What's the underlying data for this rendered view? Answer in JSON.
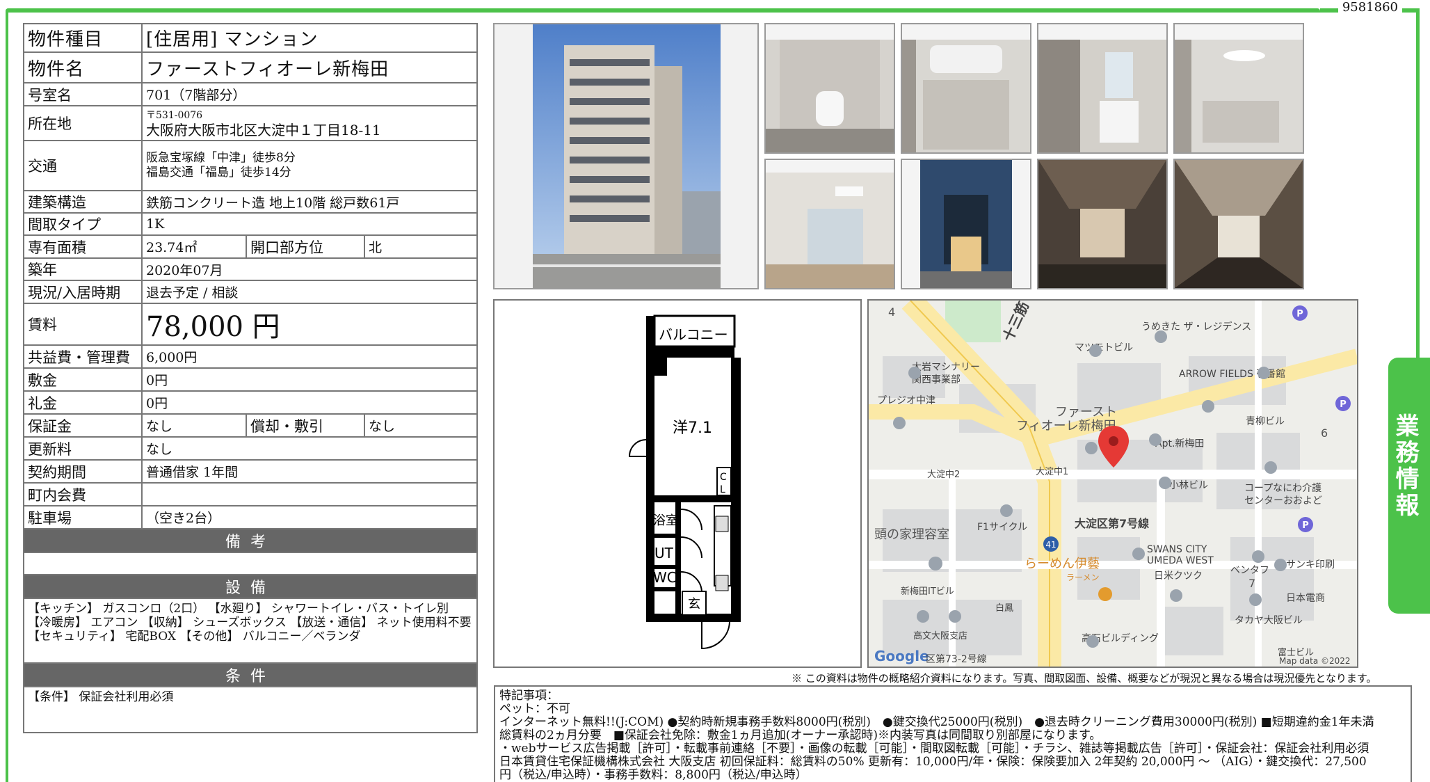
{
  "doc_id": "9581860",
  "rows": {
    "type_label": "物件種目",
    "type_value": "[住居用] マンション",
    "name_label": "物件名",
    "name_value": "ファーストフィオーレ新梅田",
    "room_label": "号室名",
    "room_value": "701（7階部分）",
    "addr_label": "所在地",
    "zip": "〒531-0076",
    "addr_value": "大阪府大阪市北区大淀中１丁目18-11",
    "transit_label": "交通",
    "transit_1": "阪急宝塚線「中津」徒歩8分",
    "transit_2": "福島交通「福島」徒歩14分",
    "structure_label": "建築構造",
    "structure_value": "鉄筋コンクリート造 地上10階 総戸数61戸",
    "layout_label": "間取タイプ",
    "layout_value": "1K",
    "area_label": "専有面積",
    "area_value": "23.74㎡",
    "dir_label": "開口部方位",
    "dir_value": "北",
    "built_label": "築年",
    "built_value": "2020年07月",
    "status_label": "現況/入居時期",
    "status_value": "退去予定 / 相談",
    "rent_label": "賃料",
    "rent_value": "78,000 円",
    "fee_label": "共益費・管理費",
    "fee_value": "6,000円",
    "deposit_label": "敷金",
    "deposit_value": "0円",
    "keymoney_label": "礼金",
    "keymoney_value": "0円",
    "guarantee_label": "保証金",
    "guarantee_value": "なし",
    "amort_label": "償却・敷引",
    "amort_value": "なし",
    "renewal_label": "更新料",
    "renewal_value": "なし",
    "contract_label": "契約期間",
    "contract_value": "普通借家 1年間",
    "assoc_label": "町内会費",
    "assoc_value": "",
    "parking_label": "駐車場",
    "parking_value": "（空き2台）"
  },
  "sections": {
    "remarks_title": "備考",
    "remarks_text": "",
    "equip_title": "設備",
    "equip_text": "【キッチン】 ガスコンロ（2口） 【水廻り】 シャワートイレ・バス・トイレ別 【冷暖房】 エアコン 【収納】 シューズボックス 【放送・通信】 ネット使用料不要 【セキュリティ】 宅配BOX 【その他】 バルコニー／ベランダ",
    "cond_title": "条件",
    "cond_text": "【条件】 保証会社利用必須"
  },
  "floorplan": {
    "balcony": "バルコニー",
    "room": "洋7.1",
    "cl_c": "C",
    "cl_l": "L",
    "bath": "浴室",
    "ut": "UT",
    "wc": "WC",
    "entrance": "玄"
  },
  "map": {
    "street_jusan": "十三筋",
    "n4": "4",
    "umekita": "うめきた ザ・レジデンス",
    "matsumoto": "マツモトビル",
    "arrow_fields": "ARROW FIELDS 壱番館",
    "oiwa_1": "大岩マシナリー",
    "oiwa_2": "関西事業部",
    "purejio": "プレジオ中津",
    "target_1": "ファースト",
    "target_2": "フィオーレ新梅田",
    "apt": "Apt.新梅田",
    "aoyagi": "青柳ビル",
    "n6": "6",
    "coop_1": "コープなにわ介護",
    "coop_2": "センターおおよど",
    "kobayashi": "小林ビル",
    "oyodo2": "大淀中2",
    "oyodo1": "大淀中1",
    "oyodo7": "大淀区第7号線",
    "f1": "F1サイクル",
    "route41": "41",
    "hairdresser": "頭の家理容室",
    "swans_1": "SWANS CITY",
    "swans_2": "UMEDA WEST",
    "nichibei": "日米クツク",
    "bentafu": "ベンタフ",
    "n7": "7",
    "sanki": "サンキ印刷",
    "ramen_1": "らーめん伊藝",
    "ramen_2": "ラーメン",
    "nihondenki": "日本電商",
    "shinumeda_it": "新梅田ITビル",
    "hakuho": "白鳳",
    "takaya": "タカヤ大阪ビル",
    "kobun": "高文大阪支店",
    "takaishi": "高石ビルディング",
    "fujishi": "富士ビル",
    "google": "Google",
    "ku73": "区第73-2号線",
    "mapdata": "Map data ©2022",
    "p": "P"
  },
  "disclaimer": "※ この資料は物件の概略紹介資料になります。写真、間取図面、設備、概要などが現況と異なる場合は現況優先となります。",
  "special_notes": [
    "特記事項：",
    "ペット：不可",
    "インターネット無料!!(J:COM) ●契約時新規事務手数料8000円(税別)　●鍵交換代25000円(税別)　●退去時クリーニング費用30000円(税別) ■短期違約金1年未満",
    "総賃料の2ヵ月分要　■保証会社免除：敷金1ヵ月追加(オーナー承認時)※内装写真は同間取り別部屋になります。",
    "・webサービス広告掲載［許可］・転載事前連絡［不要］・画像の転載［可能］・間取図転載［可能］・チラシ、雑誌等掲載広告［許可］・保証会社：保証会社利用必須",
    " 日本賃貸住宅保証機構株式会社 大阪支店 初回保証料：総賃料の50% 更新有：10,000円/年・保険：保険要加入 2年契約 20,000円 〜 （AIG）・鍵交換代：27,500",
    "円（税込/申込時）・事務手数料：8,800円（税込/申込時）"
  ],
  "side_tab": "業務情報",
  "colors": {
    "accent": "#4cc24a",
    "section_bg": "#666666",
    "map_road": "#fbe9a6",
    "pin": "#e53935"
  }
}
